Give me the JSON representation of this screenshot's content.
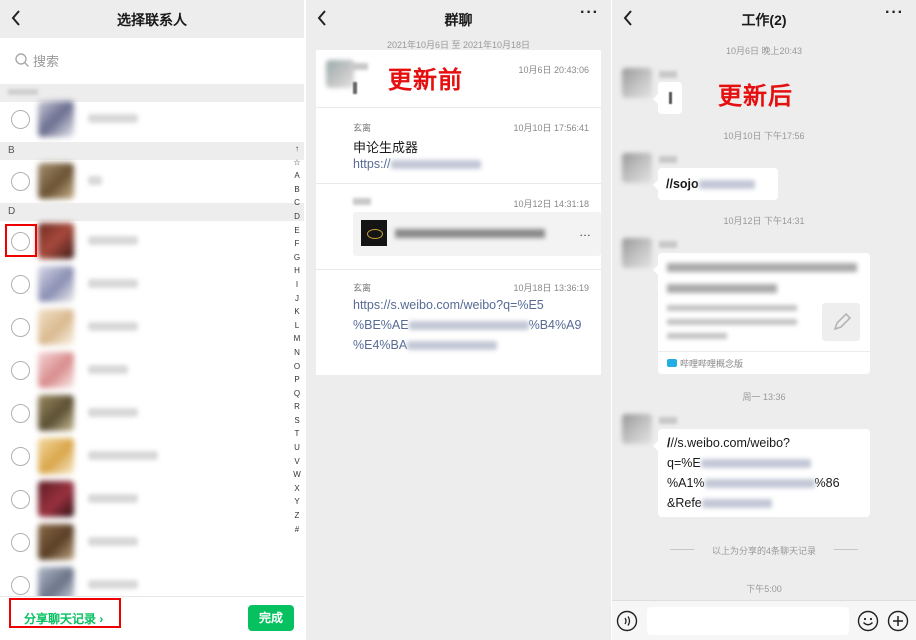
{
  "panel1": {
    "title": "选择联系人",
    "search_placeholder": "搜索",
    "sections": [
      "B",
      "D"
    ],
    "alphabet": [
      "↑",
      "☆",
      "A",
      "B",
      "C",
      "D",
      "E",
      "F",
      "G",
      "H",
      "I",
      "J",
      "K",
      "L",
      "M",
      "N",
      "O",
      "P",
      "Q",
      "R",
      "S",
      "T",
      "U",
      "V",
      "W",
      "X",
      "Y",
      "Z",
      "#"
    ],
    "share_label": "分享聊天记录 ›",
    "done_label": "完成"
  },
  "panel2": {
    "title": "群聊",
    "date_range": "2021年10月6日 至 2021年10月18日",
    "overlay": "更新前",
    "records": [
      {
        "time": "10月6日 20:43:06",
        "text": ""
      },
      {
        "sender": "玄离",
        "time": "10月10日 17:56:41",
        "text": "申论生成器",
        "link_prefix": "https://"
      },
      {
        "time": "10月12日 14:31:18",
        "card_text_end": "…"
      },
      {
        "sender": "玄离",
        "time": "10月18日 13:36:19",
        "link_line1": "https://s.weibo.com/weibo?q=%E5",
        "link_line2a": "%BE%AE",
        "link_line2b": "%B4%A9",
        "link_line3a": "%E4%BA"
      }
    ]
  },
  "panel3": {
    "title": "工作(2)",
    "overlay": "更新后",
    "timestamps": [
      "10月6日 晚上20:43",
      "10月10日 下午17:56",
      "10月12日 下午14:31",
      "周一 13:36",
      "下午5:00"
    ],
    "msg2_prefix": "//sojo",
    "msg3_source": "哔哩哔哩概念版",
    "msg4_line1": "//s.weibo.com/weibo?",
    "msg4_line2": "q=%E",
    "msg4_line3a": "%A1%",
    "msg4_line3b": "%86",
    "msg4_line4": "&Refe",
    "divider_text": "以上为分享的4条聊天记录"
  },
  "colors": {
    "accent_green": "#07c160",
    "link_blue": "#576b95",
    "overlay_red": "#e60f0f",
    "highlight_red": "#ee0000"
  }
}
